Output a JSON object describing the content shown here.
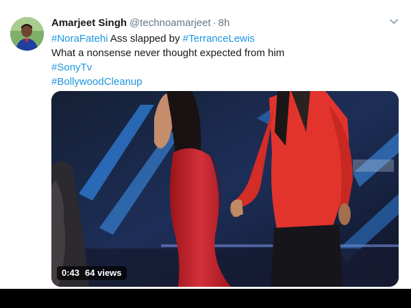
{
  "tweet": {
    "author_name": "Amarjeet Singh",
    "handle": "@technoamarjeet",
    "separator": "·",
    "time": "8h",
    "line1": {
      "hashtag1": "#NoraFatehi",
      "text": " Ass slapped by ",
      "hashtag2": "#TerranceLewis"
    },
    "line2": "What a nonsense never thought expected from him",
    "line3_hashtag": "#SonyTv",
    "line4_hashtag": "#BollywoodCleanup"
  },
  "video": {
    "duration": "0:43",
    "views": "64 views"
  },
  "colors": {
    "link": "#1b95e0",
    "text": "#14171a",
    "muted": "#657786",
    "dress": "#c9242b",
    "jacket": "#e2342d",
    "stage_blue": "#2f7fd9"
  },
  "icons": [
    "avatar",
    "chevron-down-icon"
  ]
}
